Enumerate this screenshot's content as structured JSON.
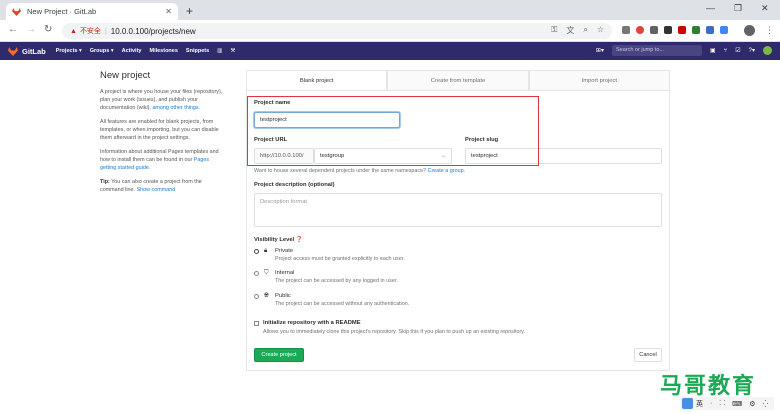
{
  "browser": {
    "tab_title": "New Project · GitLab",
    "new_tab": "+",
    "insecure_label": "不安全",
    "url": "10.0.0.100/projects/new"
  },
  "gitlab_header": {
    "brand": "GitLab",
    "nav": [
      "Projects ▾",
      "Groups ▾",
      "Activity",
      "Milestones",
      "Snippets"
    ],
    "search_placeholder": "Search or jump to...",
    "accent": "#2f2a6b"
  },
  "left": {
    "title": "New project",
    "p1_text": "A project is where you house your files (repository), plan your work (issues), and publish your documentation (wiki), ",
    "p1_link": "among other things.",
    "p2": "All features are enabled for blank projects, from templates, or when importing, but you can disable them afterward in the project settings.",
    "p3_text": "Information about additional Pages templates and how to install them can be found in our ",
    "p3_link": "Pages getting started guide.",
    "tip_label": "Tip:",
    "tip_text": " You can also create a project from the command line. ",
    "tip_link": "Show command"
  },
  "tabs": [
    "Blank project",
    "Create from template",
    "Import project"
  ],
  "form": {
    "project_name_label": "Project name",
    "project_name_value": "testproject",
    "project_url_label": "Project URL",
    "url_prefix": "http://10.0.0.100/",
    "namespace": "testgroup",
    "slug_label": "Project slug",
    "slug_value": "testproject",
    "namespace_help": "Want to house several dependent projects under the same namespace? ",
    "namespace_help_link": "Create a group.",
    "description_label": "Project description (optional)",
    "description_placeholder": "Description format",
    "visibility_label": "Visibility Level",
    "visibility": [
      {
        "title": "Private",
        "desc": "Project access must be granted explicitly to each user.",
        "checked": true
      },
      {
        "title": "Internal",
        "desc": "The project can be accessed by any logged in user.",
        "checked": false
      },
      {
        "title": "Public",
        "desc": "The project can be accessed without any authentication.",
        "checked": false
      }
    ],
    "init_label": "Initialize repository with a README",
    "init_help": "Allows you to immediately clone this project's repository. Skip this if you plan to push up an existing repository.",
    "create_button": "Create project",
    "cancel_button": "Cancel"
  },
  "watermark": {
    "text": "马哥教育",
    "bar": [
      "英",
      "·",
      "⸬",
      "⌨",
      "⚙",
      "⁛"
    ]
  }
}
